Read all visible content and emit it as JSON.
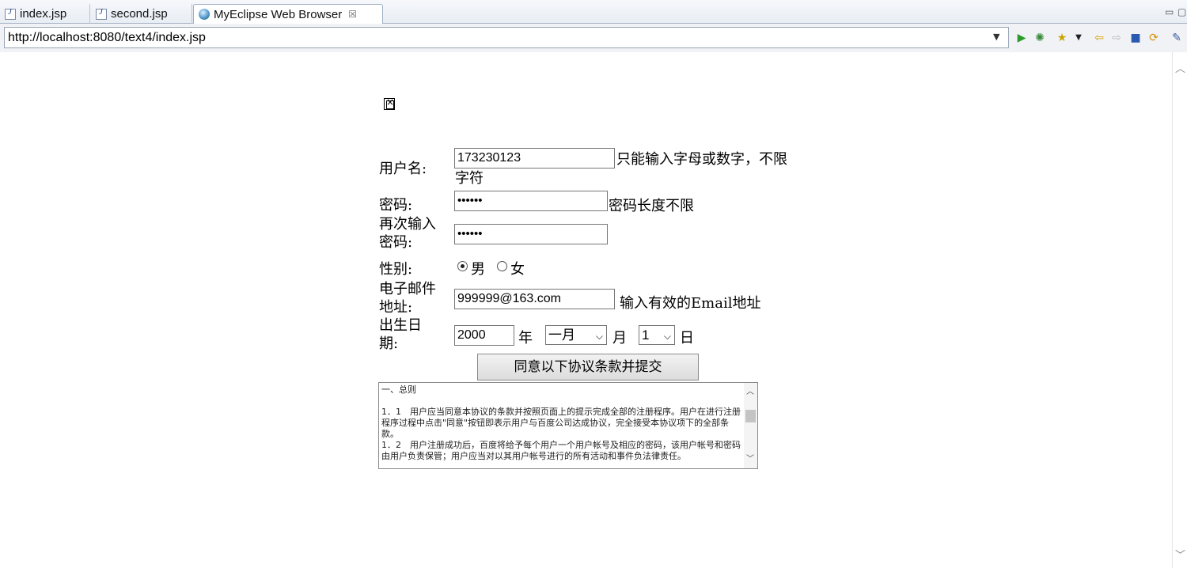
{
  "tabs": [
    {
      "label": "index.jsp",
      "icon": "jsp-file-icon",
      "active": false
    },
    {
      "label": "second.jsp",
      "icon": "jsp-file-icon",
      "active": false
    },
    {
      "label": "MyEclipse Web Browser",
      "icon": "globe-icon",
      "active": true
    }
  ],
  "address": {
    "url": "http://localhost:8080/text4/index.jsp"
  },
  "toolbar": {
    "icons": [
      "go-icon",
      "debug-icon",
      "bookmark-icon",
      "back-icon",
      "forward-icon",
      "stop-icon",
      "refresh-icon",
      "eclipse-icon"
    ]
  },
  "form": {
    "username": {
      "label": "用户名:",
      "value": "173230123",
      "hint": "只能输入字母或数字，不限字符"
    },
    "password": {
      "label": "密码:",
      "value": "••••••",
      "hint": "密码长度不限"
    },
    "confirm": {
      "label": "再次输入密码:",
      "value": "••••••"
    },
    "gender": {
      "label": "性别:",
      "options": [
        "男",
        "女"
      ],
      "selected": "男"
    },
    "email": {
      "label": "电子邮件地址:",
      "value": "999999@163.com",
      "hint": "输入有效的Email地址"
    },
    "birth": {
      "label": "出生日期:",
      "year": "2000",
      "year_unit": "年",
      "month": "一月",
      "month_unit": "月",
      "day": "1",
      "day_unit": "日"
    },
    "submit_label": "同意以下协议条款并提交",
    "agreement": [
      "一、总则",
      "",
      "1．1　用户应当同意本协议的条款并按照页面上的提示完成全部的注册程序。用户在进行注册程序过程中点击\"同意\"按钮即表示用户与百度公司达成协议，完全接受本协议项下的全部条款。",
      "1．2　用户注册成功后，百度将给予每个用户一个用户帐号及相应的密码，该用户帐号和密码由用户负责保管；用户应当对以其用户帐号进行的所有活动和事件负法律责任。"
    ]
  }
}
